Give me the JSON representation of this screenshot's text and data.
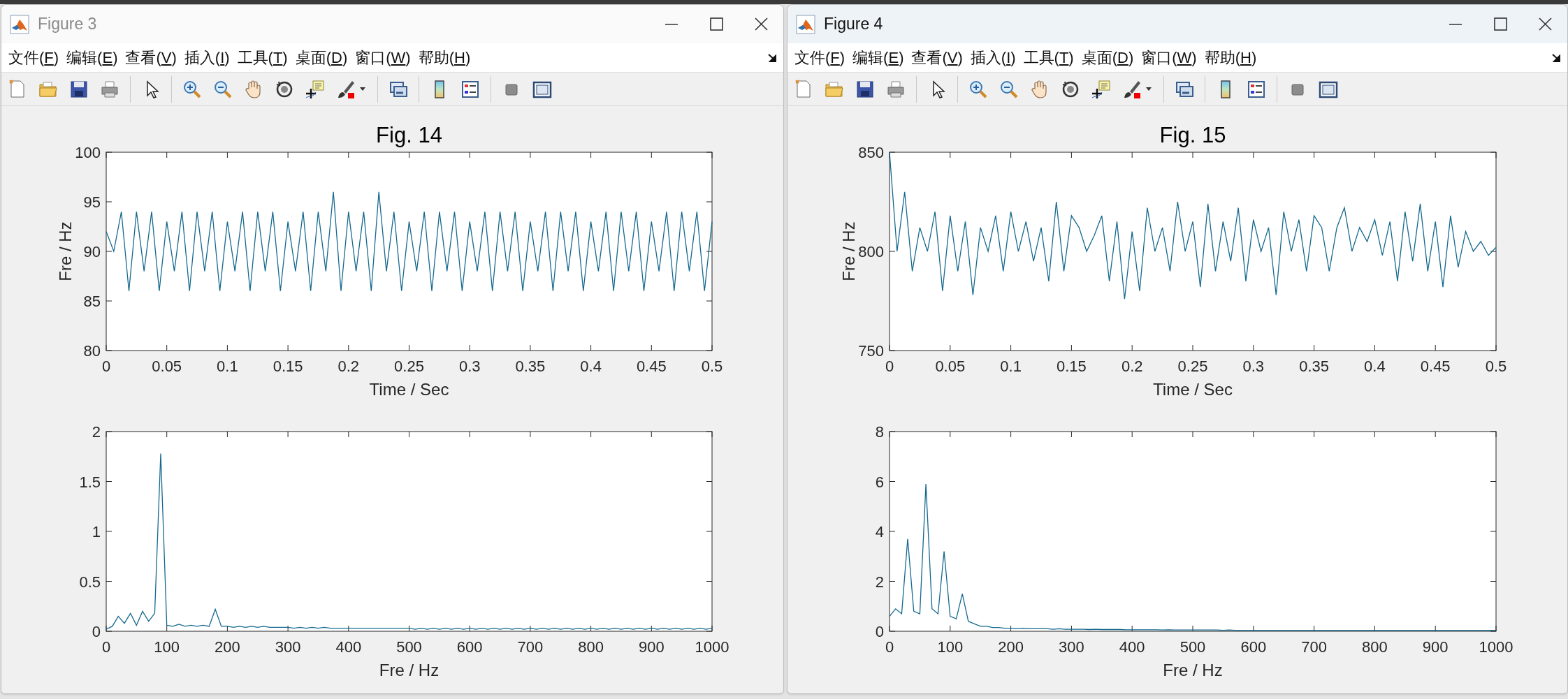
{
  "windows": [
    {
      "title": "Figure 3",
      "active": false,
      "menu": [
        "文件(F)",
        "编辑(E)",
        "查看(V)",
        "插入(I)",
        "工具(T)",
        "桌面(D)",
        "窗口(W)",
        "帮助(H)"
      ],
      "plots": [
        {
          "chart_data": {
            "type": "line",
            "title": "Fig. 14",
            "xlabel": "Time / Sec",
            "ylabel": "Fre / Hz",
            "xlim": [
              0,
              0.5
            ],
            "ylim": [
              80,
              100
            ],
            "xticks": [
              0,
              0.05,
              0.1,
              0.15,
              0.2,
              0.25,
              0.3,
              0.35,
              0.4,
              0.45,
              0.5
            ],
            "yticks": [
              80,
              85,
              90,
              95,
              100
            ],
            "x": [
              0,
              0.00625,
              0.0125,
              0.01875,
              0.025,
              0.03125,
              0.0375,
              0.04375,
              0.05,
              0.05625,
              0.0625,
              0.06875,
              0.075,
              0.08125,
              0.0875,
              0.09375,
              0.1,
              0.10625,
              0.1125,
              0.11875,
              0.125,
              0.13125,
              0.1375,
              0.14375,
              0.15,
              0.15625,
              0.1625,
              0.16875,
              0.175,
              0.18125,
              0.1875,
              0.19375,
              0.2,
              0.20625,
              0.2125,
              0.21875,
              0.225,
              0.23125,
              0.2375,
              0.24375,
              0.25,
              0.25625,
              0.2625,
              0.26875,
              0.275,
              0.28125,
              0.2875,
              0.29375,
              0.3,
              0.30625,
              0.3125,
              0.31875,
              0.325,
              0.33125,
              0.3375,
              0.34375,
              0.35,
              0.35625,
              0.3625,
              0.36875,
              0.375,
              0.38125,
              0.3875,
              0.39375,
              0.4,
              0.40625,
              0.4125,
              0.41875,
              0.425,
              0.43125,
              0.4375,
              0.44375,
              0.45,
              0.45625,
              0.4625,
              0.46875,
              0.475,
              0.48125,
              0.4875,
              0.49375,
              0.5
            ],
            "series": [
              {
                "color": "#15698f",
                "values": [
                  92,
                  90,
                  94,
                  86,
                  94,
                  88,
                  94,
                  86,
                  93,
                  88,
                  94,
                  86,
                  94,
                  88,
                  94,
                  86,
                  93,
                  88,
                  94,
                  86,
                  94,
                  88,
                  94,
                  86,
                  93,
                  88,
                  94,
                  86,
                  94,
                  88,
                  96,
                  86,
                  94,
                  88,
                  94,
                  86,
                  96,
                  88,
                  94,
                  86,
                  93,
                  88,
                  94,
                  86,
                  94,
                  88,
                  94,
                  86,
                  93,
                  88,
                  94,
                  86,
                  94,
                  88,
                  94,
                  86,
                  93,
                  88,
                  94,
                  86,
                  94,
                  88,
                  94,
                  86,
                  93,
                  88,
                  94,
                  86,
                  94,
                  88,
                  94,
                  86,
                  93,
                  88,
                  94,
                  86,
                  94,
                  88,
                  94,
                  86,
                  93
                ]
              }
            ]
          }
        },
        {
          "chart_data": {
            "type": "line",
            "xlabel": "Fre / Hz",
            "xlim": [
              0,
              1000
            ],
            "ylim": [
              0,
              2
            ],
            "xticks": [
              0,
              100,
              200,
              300,
              400,
              500,
              600,
              700,
              800,
              900,
              1000
            ],
            "yticks": [
              0,
              0.5,
              1,
              1.5,
              2
            ],
            "x": [
              0,
              10,
              20,
              30,
              40,
              50,
              60,
              70,
              80,
              90,
              100,
              110,
              120,
              130,
              140,
              150,
              160,
              170,
              180,
              190,
              200,
              210,
              220,
              230,
              240,
              250,
              260,
              270,
              280,
              290,
              300,
              310,
              320,
              330,
              340,
              350,
              360,
              370,
              380,
              390,
              400,
              410,
              420,
              430,
              440,
              450,
              460,
              470,
              480,
              490,
              500,
              510,
              520,
              530,
              540,
              550,
              560,
              570,
              580,
              590,
              600,
              610,
              620,
              630,
              640,
              650,
              660,
              670,
              680,
              690,
              700,
              710,
              720,
              730,
              740,
              750,
              760,
              770,
              780,
              790,
              800,
              810,
              820,
              830,
              840,
              850,
              860,
              870,
              880,
              890,
              900,
              910,
              920,
              930,
              940,
              950,
              960,
              970,
              980,
              990,
              1000
            ],
            "series": [
              {
                "color": "#15698f",
                "values": [
                  0.02,
                  0.05,
                  0.15,
                  0.08,
                  0.18,
                  0.06,
                  0.2,
                  0.1,
                  0.18,
                  1.78,
                  0.06,
                  0.05,
                  0.07,
                  0.05,
                  0.06,
                  0.05,
                  0.06,
                  0.05,
                  0.22,
                  0.05,
                  0.05,
                  0.04,
                  0.05,
                  0.04,
                  0.05,
                  0.04,
                  0.05,
                  0.04,
                  0.04,
                  0.04,
                  0.04,
                  0.03,
                  0.04,
                  0.03,
                  0.04,
                  0.03,
                  0.04,
                  0.03,
                  0.03,
                  0.03,
                  0.03,
                  0.03,
                  0.03,
                  0.03,
                  0.03,
                  0.03,
                  0.03,
                  0.03,
                  0.03,
                  0.03,
                  0.03,
                  0.02,
                  0.03,
                  0.02,
                  0.03,
                  0.02,
                  0.03,
                  0.02,
                  0.03,
                  0.02,
                  0.03,
                  0.02,
                  0.03,
                  0.02,
                  0.03,
                  0.02,
                  0.03,
                  0.02,
                  0.03,
                  0.02,
                  0.03,
                  0.02,
                  0.03,
                  0.02,
                  0.03,
                  0.02,
                  0.03,
                  0.02,
                  0.03,
                  0.02,
                  0.03,
                  0.02,
                  0.03,
                  0.02,
                  0.03,
                  0.02,
                  0.03,
                  0.02,
                  0.03,
                  0.02,
                  0.03,
                  0.02,
                  0.03,
                  0.02,
                  0.03,
                  0.02,
                  0.03,
                  0.02,
                  0.03,
                  0.02,
                  0.03
                ]
              }
            ]
          }
        }
      ]
    },
    {
      "title": "Figure 4",
      "active": true,
      "menu": [
        "文件(F)",
        "编辑(E)",
        "查看(V)",
        "插入(I)",
        "工具(T)",
        "桌面(D)",
        "窗口(W)",
        "帮助(H)"
      ],
      "plots": [
        {
          "chart_data": {
            "type": "line",
            "title": "Fig. 15",
            "xlabel": "Time / Sec",
            "ylabel": "Fre / Hz",
            "xlim": [
              0,
              0.5
            ],
            "ylim": [
              750,
              850
            ],
            "xticks": [
              0,
              0.05,
              0.1,
              0.15,
              0.2,
              0.25,
              0.3,
              0.35,
              0.4,
              0.45,
              0.5
            ],
            "yticks": [
              750,
              800,
              850
            ],
            "x": [
              0,
              0.00625,
              0.0125,
              0.01875,
              0.025,
              0.03125,
              0.0375,
              0.04375,
              0.05,
              0.05625,
              0.0625,
              0.06875,
              0.075,
              0.08125,
              0.0875,
              0.09375,
              0.1,
              0.10625,
              0.1125,
              0.11875,
              0.125,
              0.13125,
              0.1375,
              0.14375,
              0.15,
              0.15625,
              0.1625,
              0.16875,
              0.175,
              0.18125,
              0.1875,
              0.19375,
              0.2,
              0.20625,
              0.2125,
              0.21875,
              0.225,
              0.23125,
              0.2375,
              0.24375,
              0.25,
              0.25625,
              0.2625,
              0.26875,
              0.275,
              0.28125,
              0.2875,
              0.29375,
              0.3,
              0.30625,
              0.3125,
              0.31875,
              0.325,
              0.33125,
              0.3375,
              0.34375,
              0.35,
              0.35625,
              0.3625,
              0.36875,
              0.375,
              0.38125,
              0.3875,
              0.39375,
              0.4,
              0.40625,
              0.4125,
              0.41875,
              0.425,
              0.43125,
              0.4375,
              0.44375,
              0.45,
              0.45625,
              0.4625,
              0.46875,
              0.475,
              0.48125,
              0.4875,
              0.49375,
              0.5
            ],
            "series": [
              {
                "color": "#15698f",
                "values": [
                  850,
                  800,
                  830,
                  790,
                  812,
                  800,
                  820,
                  780,
                  818,
                  790,
                  815,
                  778,
                  812,
                  800,
                  818,
                  790,
                  820,
                  800,
                  815,
                  795,
                  812,
                  785,
                  825,
                  790,
                  818,
                  812,
                  800,
                  808,
                  818,
                  785,
                  815,
                  776,
                  810,
                  780,
                  822,
                  800,
                  812,
                  790,
                  825,
                  800,
                  815,
                  782,
                  824,
                  790,
                  815,
                  795,
                  822,
                  785,
                  816,
                  800,
                  812,
                  778,
                  820,
                  800,
                  816,
                  790,
                  818,
                  812,
                  790,
                  812,
                  822,
                  800,
                  812,
                  805,
                  816,
                  798,
                  815,
                  785,
                  820,
                  795,
                  824,
                  790,
                  815,
                  782,
                  818,
                  792,
                  810,
                  800,
                  805,
                  798,
                  802
                ]
              }
            ]
          }
        },
        {
          "chart_data": {
            "type": "line",
            "xlabel": "Fre / Hz",
            "xlim": [
              0,
              1000
            ],
            "ylim": [
              0,
              8
            ],
            "xticks": [
              0,
              100,
              200,
              300,
              400,
              500,
              600,
              700,
              800,
              900,
              1000
            ],
            "yticks": [
              0,
              2,
              4,
              6,
              8
            ],
            "x": [
              0,
              10,
              20,
              30,
              40,
              50,
              60,
              70,
              80,
              90,
              100,
              110,
              120,
              130,
              140,
              150,
              160,
              170,
              180,
              190,
              200,
              210,
              220,
              230,
              240,
              250,
              260,
              270,
              280,
              290,
              300,
              310,
              320,
              330,
              340,
              350,
              360,
              370,
              380,
              390,
              400,
              410,
              420,
              430,
              440,
              450,
              460,
              470,
              480,
              490,
              500,
              510,
              520,
              530,
              540,
              550,
              560,
              570,
              580,
              590,
              600,
              610,
              620,
              630,
              640,
              650,
              660,
              670,
              680,
              690,
              700,
              710,
              720,
              730,
              740,
              750,
              760,
              770,
              780,
              790,
              800,
              810,
              820,
              830,
              840,
              850,
              860,
              870,
              880,
              890,
              900,
              910,
              920,
              930,
              940,
              950,
              960,
              970,
              980,
              990,
              1000
            ],
            "series": [
              {
                "color": "#15698f",
                "values": [
                  0.6,
                  0.9,
                  0.7,
                  3.7,
                  0.8,
                  0.7,
                  5.9,
                  0.9,
                  0.7,
                  3.2,
                  0.6,
                  0.5,
                  1.5,
                  0.4,
                  0.3,
                  0.2,
                  0.2,
                  0.15,
                  0.15,
                  0.12,
                  0.12,
                  0.1,
                  0.12,
                  0.1,
                  0.1,
                  0.1,
                  0.1,
                  0.08,
                  0.1,
                  0.08,
                  0.08,
                  0.08,
                  0.08,
                  0.07,
                  0.08,
                  0.07,
                  0.07,
                  0.07,
                  0.07,
                  0.06,
                  0.06,
                  0.06,
                  0.06,
                  0.06,
                  0.06,
                  0.05,
                  0.06,
                  0.05,
                  0.05,
                  0.05,
                  0.05,
                  0.05,
                  0.05,
                  0.05,
                  0.05,
                  0.04,
                  0.05,
                  0.04,
                  0.04,
                  0.04,
                  0.04,
                  0.04,
                  0.04,
                  0.04,
                  0.04,
                  0.04,
                  0.04,
                  0.04,
                  0.04,
                  0.04,
                  0.04,
                  0.04,
                  0.04,
                  0.04,
                  0.04,
                  0.04,
                  0.04,
                  0.04,
                  0.04,
                  0.04,
                  0.04,
                  0.04,
                  0.04,
                  0.04,
                  0.04,
                  0.04,
                  0.04,
                  0.04,
                  0.04,
                  0.04,
                  0.04,
                  0.04,
                  0.04,
                  0.04,
                  0.04,
                  0.04,
                  0.04,
                  0.04,
                  0.04,
                  0.04,
                  0.04
                ]
              }
            ]
          }
        }
      ]
    }
  ]
}
